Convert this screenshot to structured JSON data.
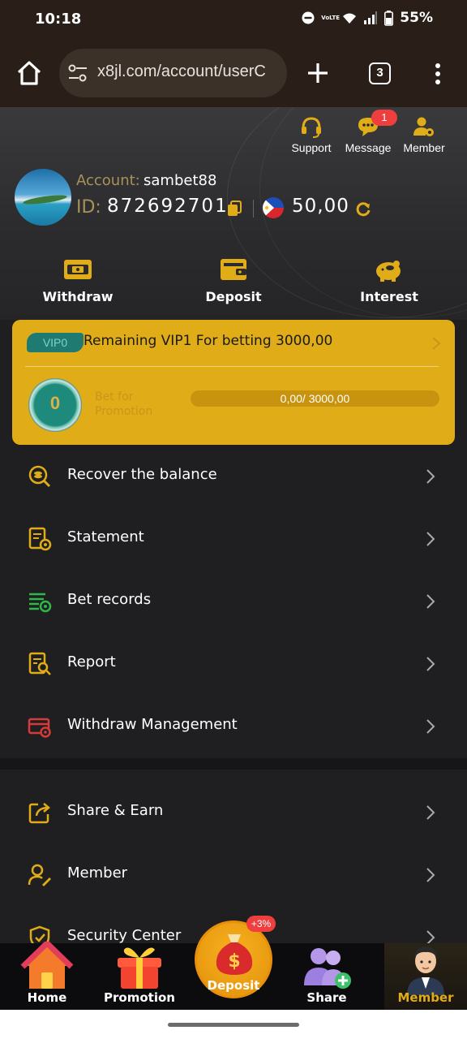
{
  "status_bar": {
    "time": "10:18",
    "network_label": "VoLTE",
    "battery": "55%"
  },
  "browser": {
    "url": "x8jl.com/account/userC",
    "tab_count": "3"
  },
  "header": {
    "top_actions": [
      {
        "label": "Support",
        "icon": "headset-icon"
      },
      {
        "label": "Message",
        "icon": "chat-icon",
        "badge": "1"
      },
      {
        "label": "Member",
        "icon": "member-gear-icon"
      }
    ],
    "account_label": "Account:",
    "account_name": "sambet88",
    "id_label": "ID:",
    "id_value": "872692701",
    "balance": "50,00",
    "quick_actions": [
      {
        "label": "Withdraw",
        "icon": "withdraw-icon"
      },
      {
        "label": "Deposit",
        "icon": "wallet-icon"
      },
      {
        "label": "Interest",
        "icon": "piggy-bank-icon"
      }
    ],
    "accent_color": "#e0ac17"
  },
  "vip": {
    "badge": "VIP0",
    "remaining_text": "Remaining VIP1 For betting 3000,00",
    "level": "0",
    "sub_label_line1": "Bet for",
    "sub_label_line2": "Promotion",
    "progress_text": "0,00/ 3000,00",
    "progress_fraction": 0.0
  },
  "menu_primary": [
    {
      "label": "Recover the balance",
      "icon": "coin-search-icon"
    },
    {
      "label": "Statement",
      "icon": "statement-icon"
    },
    {
      "label": "Bet records",
      "icon": "bet-records-icon"
    },
    {
      "label": "Report",
      "icon": "report-icon"
    },
    {
      "label": "Withdraw Management",
      "icon": "card-settings-icon"
    }
  ],
  "menu_secondary": [
    {
      "label": "Share & Earn",
      "icon": "share-icon"
    },
    {
      "label": "Member",
      "icon": "member-edit-icon"
    },
    {
      "label": "Security Center",
      "icon": "shield-check-icon"
    }
  ],
  "bottom_nav": {
    "items": [
      {
        "label": "Home",
        "icon": "house-icon"
      },
      {
        "label": "Promotion",
        "icon": "gift-icon"
      },
      {
        "label": "Deposit",
        "icon": "money-bag-icon",
        "badge": "+3%"
      },
      {
        "label": "Share",
        "icon": "users-add-icon"
      },
      {
        "label": "Member",
        "icon": "member-avatar-icon"
      }
    ]
  }
}
